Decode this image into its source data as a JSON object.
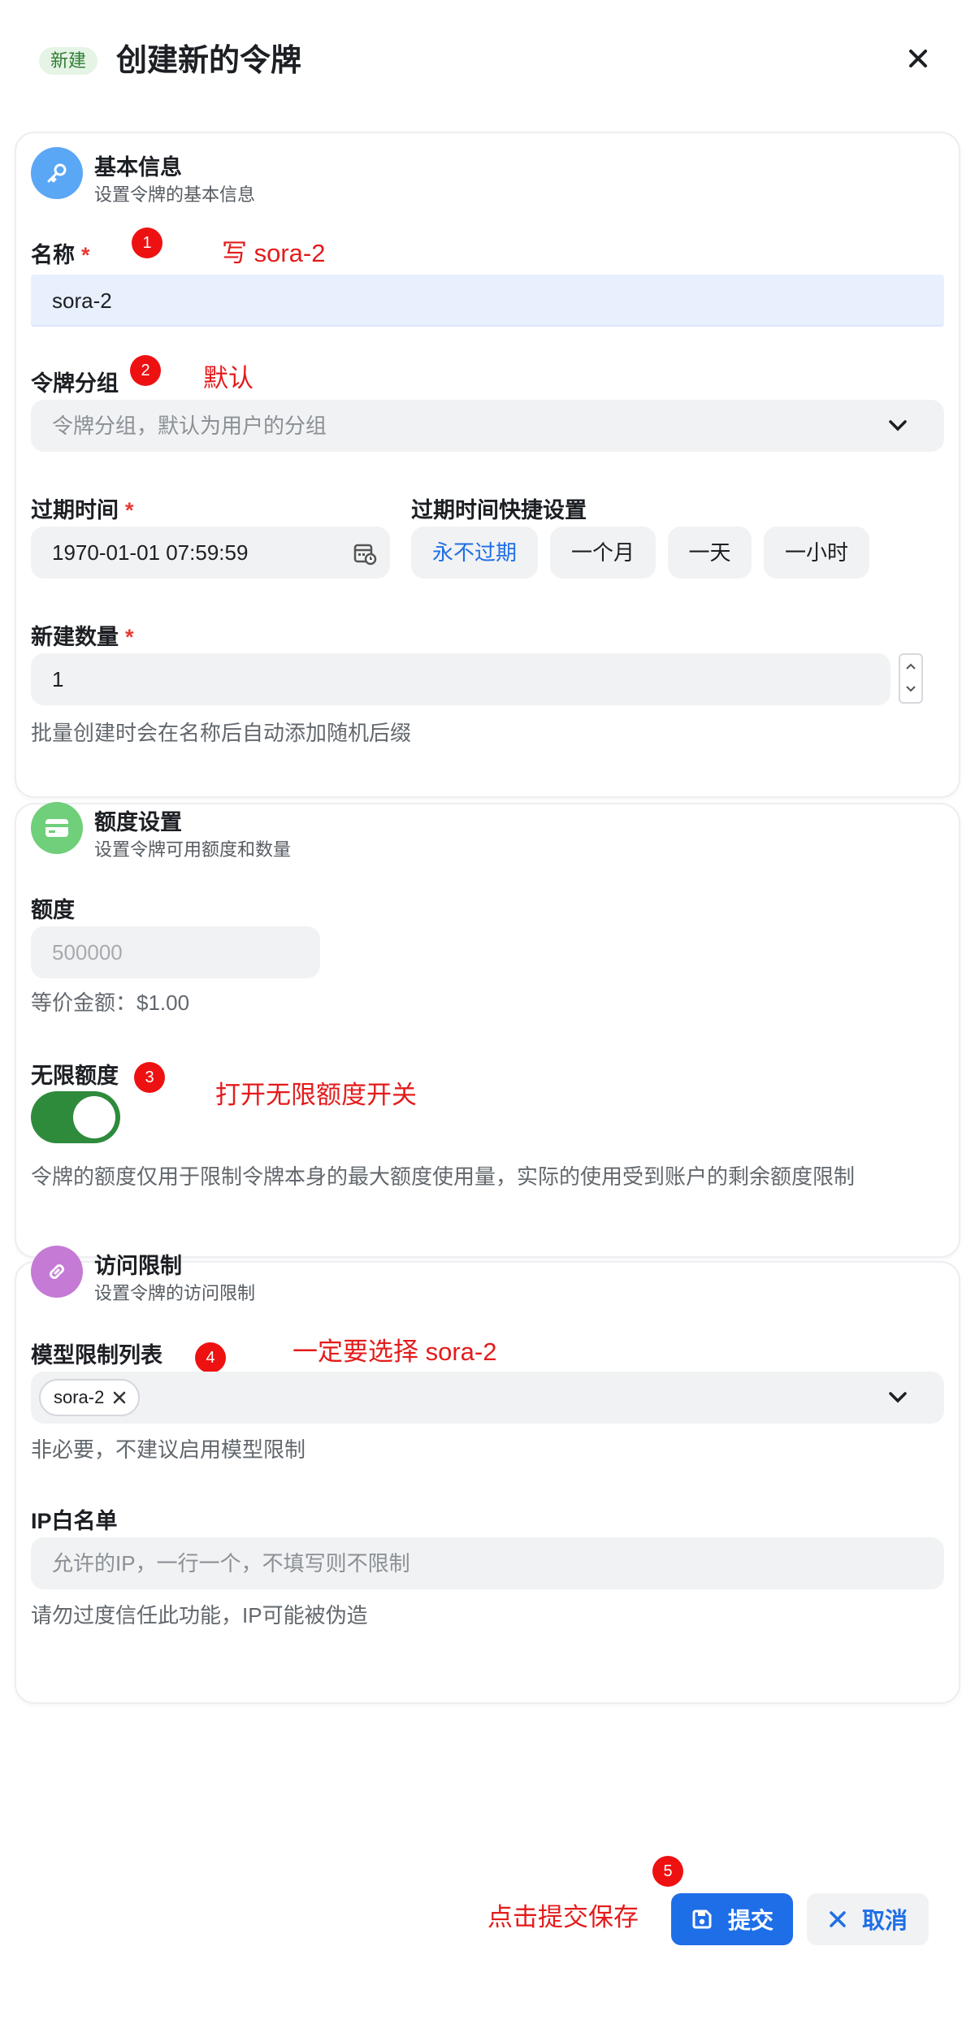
{
  "header": {
    "badge": "新建",
    "title": "创建新的令牌"
  },
  "basic": {
    "title": "基本信息",
    "subtitle": "设置令牌的基本信息",
    "name_label": "名称",
    "name_value": "sora-2",
    "group_label": "令牌分组",
    "group_placeholder": "令牌分组，默认为用户的分组",
    "expire_label": "过期时间",
    "expire_value": "1970-01-01 07:59:59",
    "quick_label": "过期时间快捷设置",
    "quick_options": [
      "永不过期",
      "一个月",
      "一天",
      "一小时"
    ],
    "count_label": "新建数量",
    "count_value": "1",
    "count_helper": "批量创建时会在名称后自动添加随机后缀"
  },
  "quota": {
    "title": "额度设置",
    "subtitle": "设置令牌可用额度和数量",
    "quota_label": "额度",
    "quota_placeholder": "500000",
    "equiv": "等价金额：$1.00",
    "unlimited_label": "无限额度",
    "unlimited_on": true,
    "helper": "令牌的额度仅用于限制令牌本身的最大额度使用量，实际的使用受到账户的剩余额度限制"
  },
  "access": {
    "title": "访问限制",
    "subtitle": "设置令牌的访问限制",
    "models_label": "模型限制列表",
    "model_tag": "sora-2",
    "models_helper": "非必要，不建议启用模型限制",
    "ip_label": "IP白名单",
    "ip_placeholder": "允许的IP，一行一个，不填写则不限制",
    "ip_helper": "请勿过度信任此功能，IP可能被伪造"
  },
  "annotations": {
    "m1": "1",
    "a1": "写 sora-2",
    "m2": "2",
    "a2": "默认",
    "m3": "3",
    "a3": "打开无限额度开关",
    "m4": "4",
    "a4": "一定要选择 sora-2",
    "m5": "5",
    "a5": "点击提交保存"
  },
  "footer": {
    "submit": "提交",
    "cancel": "取消"
  },
  "colors": {
    "primary": "#1e6ee8",
    "toggle_on": "#2e8b3c",
    "annotation": "#e41b1b",
    "required": "#e53935"
  },
  "icons": {
    "basic": "key-icon",
    "quota": "credit-card-icon",
    "access": "link-icon"
  }
}
